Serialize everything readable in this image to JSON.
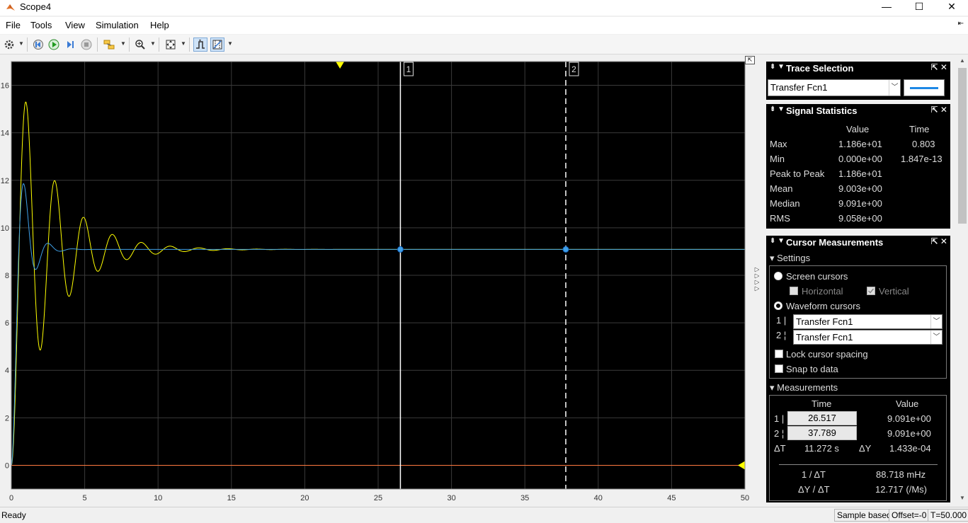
{
  "window": {
    "title": "Scope4",
    "minimize": "—",
    "maximize": "☐",
    "close": "✕"
  },
  "menu": {
    "items": [
      "File",
      "Tools",
      "View",
      "Simulation",
      "Help"
    ],
    "collapse": "⇤"
  },
  "toolbar": {
    "icons": [
      "gear-icon",
      "step-back-icon",
      "run-icon",
      "step-forward-icon",
      "stop-icon",
      "highlight-icon",
      "zoom-in-icon",
      "fit-axes-icon",
      "triggers-icon",
      "cursor-measurements-icon"
    ]
  },
  "chart_data": {
    "type": "line",
    "xlim": [
      0,
      50
    ],
    "ylim": [
      -1,
      17
    ],
    "x_ticks": [
      0,
      5,
      10,
      15,
      20,
      25,
      30,
      35,
      40,
      45,
      50
    ],
    "y_ticks": [
      0,
      2,
      4,
      6,
      8,
      10,
      12,
      14,
      16
    ],
    "x_tick_labels": [
      "0",
      "5",
      "10",
      "15",
      "20",
      "25",
      "30",
      "35",
      "40",
      "45",
      "50"
    ],
    "y_tick_labels": [
      "0",
      "2",
      "4",
      "6",
      "8",
      "10",
      "12",
      "14",
      "16"
    ],
    "grid": true,
    "background": "#000000",
    "series": [
      {
        "color": "#ffff00",
        "model": {
          "final": 9.091,
          "peak": 15.3,
          "omega": 3.2,
          "zeta": 0.05
        }
      },
      {
        "color": "#3fa0e8",
        "model": {
          "final": 9.091,
          "peak": 11.86,
          "omega": 4.0,
          "zeta": 0.32
        }
      },
      {
        "color": "#ff7a40",
        "constant": 0
      }
    ],
    "cursors": [
      {
        "label": "1",
        "x": 26.517,
        "y": 9.091,
        "style": "solid"
      },
      {
        "label": "2",
        "x": 37.789,
        "y": 9.091,
        "style": "dashed"
      }
    ],
    "trigger_marker_x": 22.4
  },
  "trace_selection": {
    "title": "Trace Selection",
    "selected": "Transfer Fcn1",
    "line_color": "#1e88e5"
  },
  "signal_statistics": {
    "title": "Signal Statistics",
    "col_value": "Value",
    "col_time": "Time",
    "rows": [
      {
        "label": "Max",
        "value": "1.186e+01",
        "time": "0.803"
      },
      {
        "label": "Min",
        "value": "0.000e+00",
        "time": "1.847e-13"
      },
      {
        "label": "Peak to Peak",
        "value": "1.186e+01",
        "time": ""
      },
      {
        "label": "Mean",
        "value": "9.003e+00",
        "time": ""
      },
      {
        "label": "Median",
        "value": "9.091e+00",
        "time": ""
      },
      {
        "label": "RMS",
        "value": "9.058e+00",
        "time": ""
      }
    ]
  },
  "cursor_measurements": {
    "title": "Cursor Measurements",
    "settings_label": "▾ Settings",
    "screen_cursors": "Screen cursors",
    "horizontal": "Horizontal",
    "vertical": "Vertical",
    "waveform_cursors": "Waveform cursors",
    "cursor1_label": "1 |",
    "cursor2_label": "2 ¦",
    "cursor1_signal": "Transfer Fcn1",
    "cursor2_signal": "Transfer Fcn1",
    "lock_spacing": "Lock cursor spacing",
    "snap_to_data": "Snap to data",
    "measurements_label": "▾ Measurements",
    "col_time": "Time",
    "col_value": "Value",
    "c1_time": "26.517",
    "c1_value": "9.091e+00",
    "c2_time": "37.789",
    "c2_value": "9.091e+00",
    "dt_label": "ΔT",
    "dt_value": "11.272 s",
    "dy_label": "ΔY",
    "dy_value": "1.433e-04",
    "inv_dt_label": "1 / ΔT",
    "inv_dt_value": "88.718 mHz",
    "dydt_label": "ΔY / ΔT",
    "dydt_value": "12.717 (/Ms)"
  },
  "status": {
    "ready": "Ready",
    "sample_based": "Sample based",
    "offset": "Offset=-0",
    "time": "T=50.000"
  }
}
